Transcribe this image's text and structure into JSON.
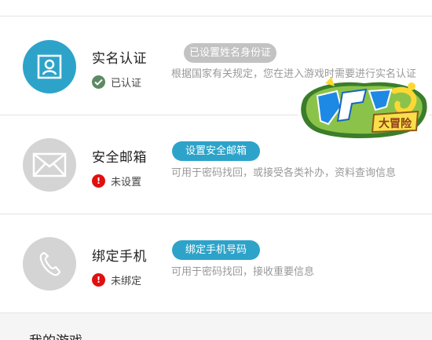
{
  "colors": {
    "accent": "#2ea3c9",
    "disabled": "#c2c2c2",
    "ok_green": "#5c8a63",
    "warn_red": "#e01010",
    "avatar_gray": "#d4d4d4"
  },
  "realname": {
    "title": "实名认证",
    "status": "已认证",
    "button": "已设置姓名身份证",
    "description": "根据国家有关规定，您在进入游戏时需要进行实名认证",
    "icon": "id-card-icon",
    "status_icon": "check-circle-icon"
  },
  "email": {
    "title": "安全邮箱",
    "status": "未设置",
    "button": "设置安全邮箱",
    "description": "可用于密码找回，或接受各类补办，资料查询信息",
    "icon": "envelope-icon",
    "status_icon": "exclamation-circle-icon"
  },
  "phone": {
    "title": "绑定手机",
    "status": "未绑定",
    "button": "绑定手机号码",
    "description": "可用于密码找回，接收重要信息",
    "icon": "phone-icon",
    "status_icon": "exclamation-circle-icon"
  },
  "section": {
    "title": "我的游戏"
  },
  "ad": {
    "icon": "game-logo-icon",
    "logo_text": "大冒险"
  }
}
